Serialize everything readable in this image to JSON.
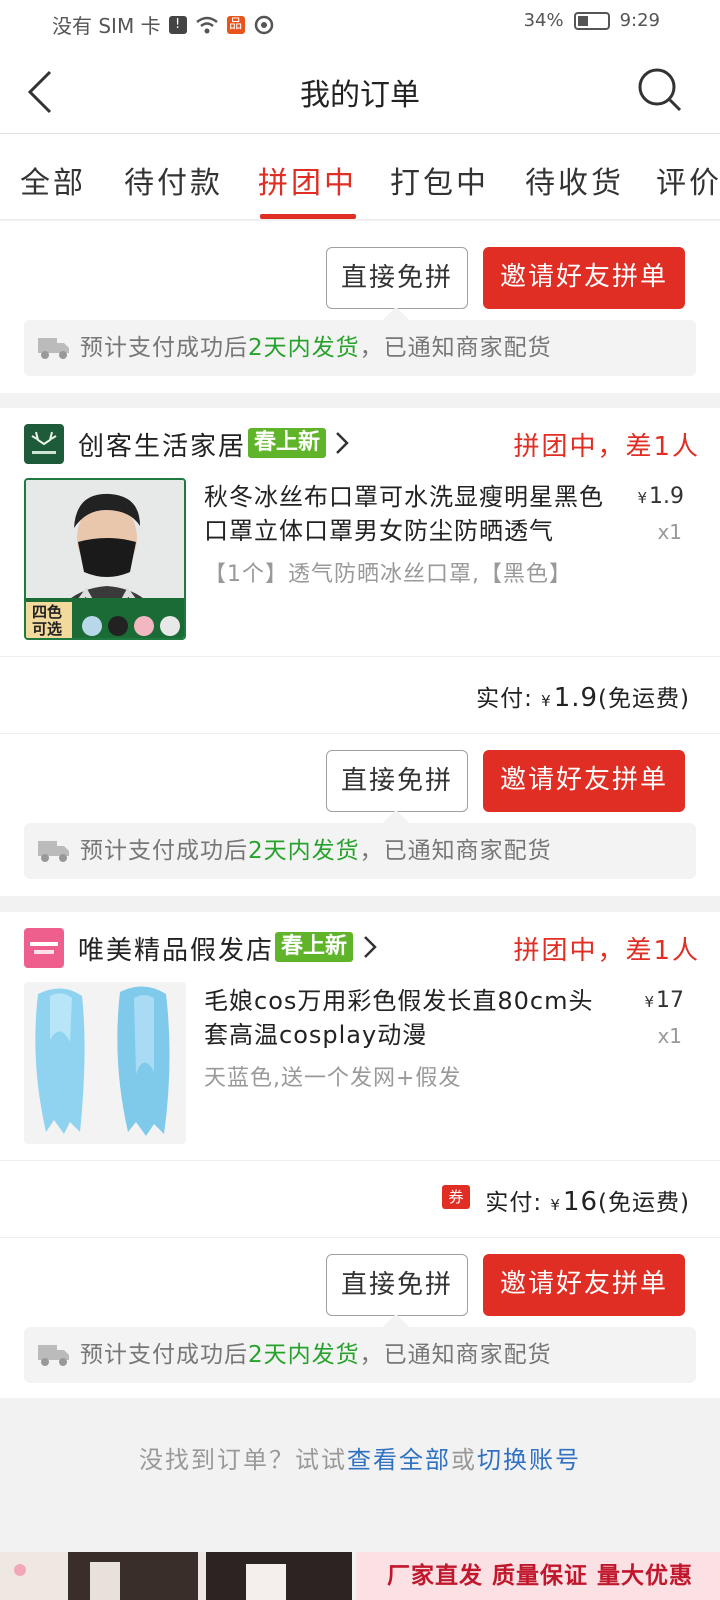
{
  "status_bar": {
    "carrier": "没有 SIM 卡",
    "battery_percent": "34%",
    "time": "9:29"
  },
  "header": {
    "title": "我的订单",
    "back_icon": "chevron-left-icon",
    "search_icon": "search-icon"
  },
  "tabs": [
    {
      "label": "全部",
      "active": false
    },
    {
      "label": "待付款",
      "active": false
    },
    {
      "label": "拼团中",
      "active": true
    },
    {
      "label": "打包中",
      "active": false
    },
    {
      "label": "待收货",
      "active": false
    },
    {
      "label": "评价",
      "active": false
    }
  ],
  "colors": {
    "accent": "#e02e24",
    "green": "#27a22c",
    "badge_green": "#5fb429",
    "link_blue": "#3071c2"
  },
  "common": {
    "direct_free_label": "直接免拼",
    "invite_label": "邀请好友拼单",
    "notice_prefix": "预计支付成功后",
    "notice_highlight": "2天内发货",
    "notice_suffix": "，已通知商家配货"
  },
  "orders": [
    {
      "shop_name": "创客生活家居",
      "shop_badge": "春上新",
      "status": "拼团中，差1人",
      "product_title": "秋冬冰丝布口罩可水洗显瘦明星黑色口罩立体口罩男女防尘防晒透气",
      "spec": "【1个】透气防晒冰丝口罩,【黑色】",
      "price": "1.9",
      "qty": "x1",
      "paid_label": "实付:",
      "paid_amount": "1.9",
      "shipping": "(免运费)",
      "thumb_tag": "四色可选",
      "coupon": ""
    },
    {
      "shop_name": "唯美精品假发店",
      "shop_badge": "春上新",
      "status": "拼团中，差1人",
      "product_title": "毛娘cos万用彩色假发长直80cm头套高温cosplay动漫",
      "spec": "天蓝色,送一个发网+假发",
      "price": "17",
      "qty": "x1",
      "paid_label": "实付:",
      "paid_amount": "16",
      "shipping": "(免运费)",
      "coupon": "券"
    }
  ],
  "footer": {
    "prefix": "没找到订单？试试",
    "view_all": "查看全部",
    "or": "或",
    "switch_account": "切换账号"
  },
  "promo": {
    "text": "厂家直发 质量保证 量大优惠"
  }
}
